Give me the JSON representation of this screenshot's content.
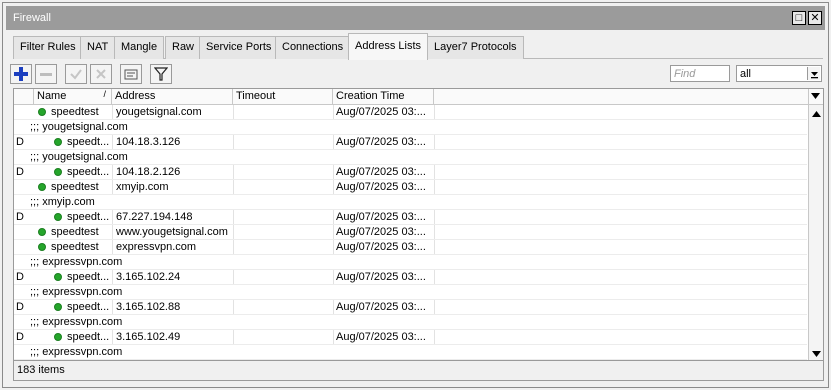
{
  "window": {
    "title": "Firewall"
  },
  "tabs": [
    {
      "label": "Filter Rules"
    },
    {
      "label": "NAT"
    },
    {
      "label": "Mangle"
    },
    {
      "label": "Raw"
    },
    {
      "label": "Service Ports"
    },
    {
      "label": "Connections"
    },
    {
      "label": "Address Lists",
      "active": true
    },
    {
      "label": "Layer7 Protocols"
    }
  ],
  "toolbar": {
    "find_placeholder": "Find",
    "filter_value": "all"
  },
  "columns": [
    "Name",
    "Address",
    "Timeout",
    "Creation Time"
  ],
  "rows": [
    {
      "type": "entry",
      "flag": "",
      "name": "speedtest",
      "address": "yougetsignal.com",
      "timeout": "",
      "created": "Aug/07/2025 03:..."
    },
    {
      "type": "comment",
      "text": ";;; yougetsignal.com"
    },
    {
      "type": "entry",
      "flag": "D",
      "name": "speedt...",
      "address": "104.18.3.126",
      "timeout": "",
      "created": "Aug/07/2025 03:..."
    },
    {
      "type": "comment",
      "text": ";;; yougetsignal.com"
    },
    {
      "type": "entry",
      "flag": "D",
      "name": "speedt...",
      "address": "104.18.2.126",
      "timeout": "",
      "created": "Aug/07/2025 03:..."
    },
    {
      "type": "entry",
      "flag": "",
      "name": "speedtest",
      "address": "xmyip.com",
      "timeout": "",
      "created": "Aug/07/2025 03:..."
    },
    {
      "type": "comment",
      "text": ";;; xmyip.com"
    },
    {
      "type": "entry",
      "flag": "D",
      "name": "speedt...",
      "address": "67.227.194.148",
      "timeout": "",
      "created": "Aug/07/2025 03:..."
    },
    {
      "type": "entry",
      "flag": "",
      "name": "speedtest",
      "address": "www.yougetsignal.com",
      "timeout": "",
      "created": "Aug/07/2025 03:..."
    },
    {
      "type": "entry",
      "flag": "",
      "name": "speedtest",
      "address": "expressvpn.com",
      "timeout": "",
      "created": "Aug/07/2025 03:..."
    },
    {
      "type": "comment",
      "text": ";;; expressvpn.com"
    },
    {
      "type": "entry",
      "flag": "D",
      "name": "speedt...",
      "address": "3.165.102.24",
      "timeout": "",
      "created": "Aug/07/2025 03:..."
    },
    {
      "type": "comment",
      "text": ";;; expressvpn.com"
    },
    {
      "type": "entry",
      "flag": "D",
      "name": "speedt...",
      "address": "3.165.102.88",
      "timeout": "",
      "created": "Aug/07/2025 03:..."
    },
    {
      "type": "comment",
      "text": ";;; expressvpn.com"
    },
    {
      "type": "entry",
      "flag": "D",
      "name": "speedt...",
      "address": "3.165.102.49",
      "timeout": "",
      "created": "Aug/07/2025 03:..."
    },
    {
      "type": "comment",
      "text": ";;; expressvpn.com"
    }
  ],
  "status": {
    "items": "183 items"
  },
  "colors": {
    "enabled_dot": "#25a52b",
    "add_icon": "#1c3fbf"
  }
}
